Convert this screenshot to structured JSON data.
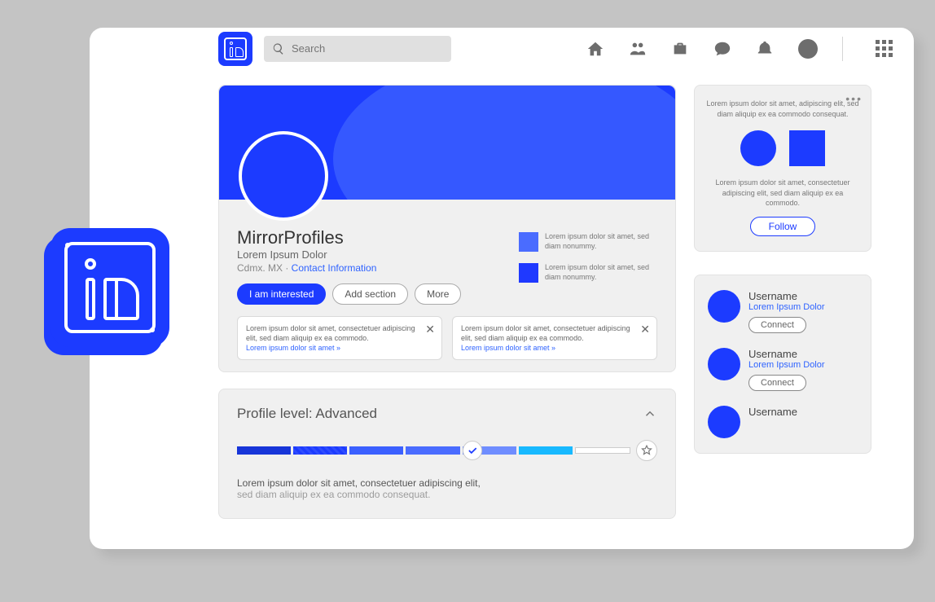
{
  "search": {
    "placeholder": "Search"
  },
  "profile": {
    "name": "MirrorProfiles",
    "headline": "Lorem Ipsum Dolor",
    "location": "Cdmx. MX · ",
    "contact_link": "Contact Information",
    "actions": {
      "interested": "I am interested",
      "add_section": "Add section",
      "more": "More"
    },
    "info1": "Lorem ipsum dolor sit amet, sed diam nonummy.",
    "info2": "Lorem ipsum dolor sit amet, sed diam nonummy.",
    "notice_body": "Lorem ipsum dolor sit amet, consectetuer adipiscing elit, sed diam aliquip ex ea commodo.",
    "notice_link": "Lorem ipsum dolor sit amet »"
  },
  "level": {
    "title": "Profile level: Advanced",
    "body_strong": "Lorem ipsum dolor sit amet, consectetuer adipiscing elit,",
    "body_rest": "sed diam aliquip ex ea commodo consequat."
  },
  "promo": {
    "line1": "Lorem ipsum dolor sit amet, adipiscing elit, sed diam aliquip ex ea commodo consequat.",
    "line2": "Lorem ipsum dolor sit amet, consectetuer adipiscing elit, sed diam aliquip ex ea commodo.",
    "follow": "Follow"
  },
  "people": [
    {
      "name": "Username",
      "desc": "Lorem Ipsum Dolor",
      "btn": "Connect"
    },
    {
      "name": "Username",
      "desc": "Lorem Ipsum Dolor",
      "btn": "Connect"
    },
    {
      "name": "Username",
      "desc": "",
      "btn": ""
    }
  ]
}
